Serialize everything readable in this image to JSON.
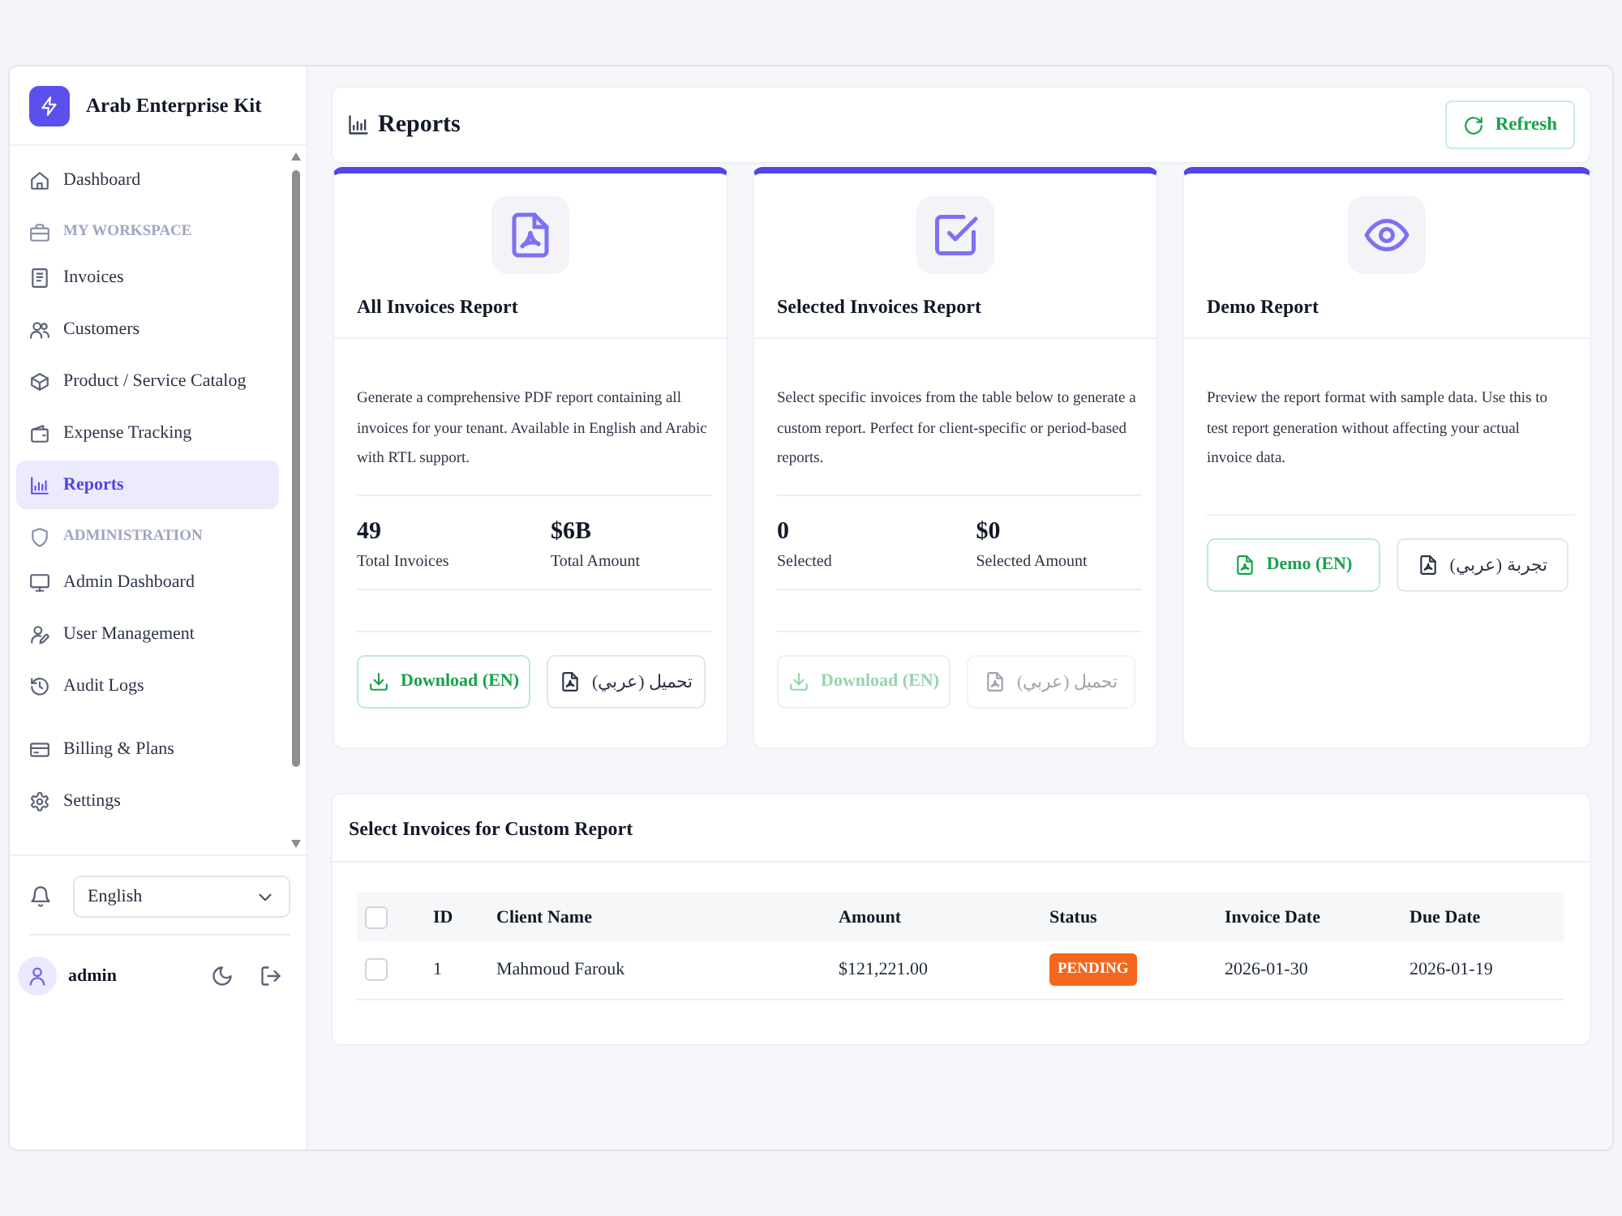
{
  "sidebar": {
    "brand": "Arab Enterprise Kit",
    "groups": [
      {
        "items": [
          {
            "label": "Dashboard",
            "selected": false
          }
        ]
      },
      {
        "heading": "MY WORKSPACE",
        "items": [
          {
            "label": "Invoices",
            "selected": false
          },
          {
            "label": "Customers",
            "selected": false
          },
          {
            "label": "Product / Service Catalog",
            "selected": false
          },
          {
            "label": "Expense Tracking",
            "selected": false
          },
          {
            "label": "Reports",
            "selected": true
          }
        ]
      },
      {
        "heading": "ADMINISTRATION",
        "items": [
          {
            "label": "Admin Dashboard",
            "selected": false
          },
          {
            "label": "User Management",
            "selected": false
          },
          {
            "label": "Audit Logs",
            "selected": false
          }
        ]
      },
      {
        "items": [
          {
            "label": "Billing & Plans",
            "selected": false
          },
          {
            "label": "Settings",
            "selected": false
          }
        ]
      }
    ],
    "language": {
      "value": "English"
    },
    "user": {
      "name": "admin"
    }
  },
  "header": {
    "title": "Reports",
    "refresh_button": "Refresh"
  },
  "cards": [
    {
      "kind": "all",
      "title": "All Invoices Report",
      "description": "Generate a comprehensive PDF report containing all invoices for your tenant. Available in English and Arabic with RTL support.",
      "stats": [
        {
          "value": "49",
          "label": "Total Invoices"
        },
        {
          "value": "$6B",
          "label": "Total Amount"
        }
      ],
      "buttons": [
        {
          "label": "Download (EN)",
          "kind": "primary",
          "disabled": false
        },
        {
          "label": "تحميل (عربي)",
          "kind": "secondary",
          "disabled": false
        }
      ]
    },
    {
      "kind": "selected",
      "title": "Selected Invoices Report",
      "description": "Select specific invoices from the table below to generate a custom report. Perfect for client-specific or period-based reports.",
      "stats": [
        {
          "value": "0",
          "label": "Selected"
        },
        {
          "value": "$0",
          "label": "Selected Amount"
        }
      ],
      "buttons": [
        {
          "label": "Download (EN)",
          "kind": "primary",
          "disabled": true
        },
        {
          "label": "تحميل (عربي)",
          "kind": "secondary",
          "disabled": true
        }
      ]
    },
    {
      "kind": "demo",
      "title": "Demo Report",
      "description": "Preview the report format with sample data. Use this to test report generation without affecting your actual invoice data.",
      "buttons": [
        {
          "label": "Demo (EN)",
          "kind": "primary",
          "disabled": false
        },
        {
          "label": "تجربة (عربي)",
          "kind": "secondary",
          "disabled": false
        }
      ]
    }
  ],
  "invoice_table": {
    "title": "Select Invoices for Custom Report",
    "select_all": false,
    "columns": [
      "ID",
      "Client Name",
      "Amount",
      "Status",
      "Invoice Date",
      "Due Date"
    ],
    "rows": [
      {
        "selected": false,
        "id": "1",
        "client": "Mahmoud Farouk",
        "amount": "$121,221.00",
        "status": {
          "label": "PENDING",
          "color": "#f4661b"
        },
        "invoice_date": "2026-01-30",
        "due_date": "2026-01-19"
      }
    ]
  }
}
